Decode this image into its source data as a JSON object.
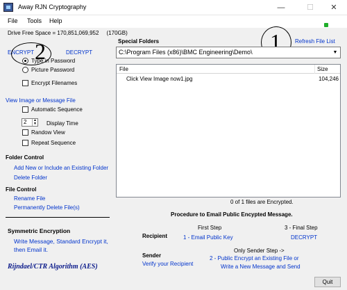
{
  "window": {
    "title": "Away RJN  Cryptography",
    "minimize": "—",
    "maximize": "☐",
    "close": "✕"
  },
  "menu": {
    "file": "File",
    "tools": "Tools",
    "help": "Help"
  },
  "drive_info": "Drive Free Space = 170,851,069,952     (170GB)",
  "mode": {
    "encrypt": "ENCRYPT",
    "decrypt": "DECRYPT"
  },
  "annotations": {
    "one": "1",
    "two": "2"
  },
  "special_folders": {
    "label": "Special Folders",
    "refresh": "Refresh File List",
    "path": "C:\\Program Files (x86)\\BMC Engineering\\Demo\\"
  },
  "options": {
    "type_in_password": "Type in Password",
    "picture_password": "Picture Password",
    "encrypt_filenames": "Encrypt Filenames"
  },
  "view": {
    "link": "View Image or Message File",
    "automatic_sequence": "Automatic Sequence",
    "display_time_value": "2",
    "display_time_label": "Display Time",
    "random_view": "Randow View",
    "repeat_sequence": "Repeat Sequence"
  },
  "folder_control": {
    "title": "Folder Control",
    "add": "Add New or Include an Existing Folder",
    "delete": "Delete Folder"
  },
  "file_control": {
    "title": "File Control",
    "rename": "Rename File",
    "delete": "Permanently Delete File(s)"
  },
  "symmetric": {
    "title": "Symmetric Encryption",
    "line1": "Write Message, Standard Encrypt it,",
    "line2": "then Email it.",
    "algorithm": "Rijndael/CTR Algorithm (AES)"
  },
  "file_list": {
    "col_file": "File",
    "col_size": "Size",
    "rows": [
      {
        "name": "Click View Image now1.jpg",
        "size": "104,246"
      }
    ]
  },
  "encrypted_status": "0 of 1 files are Encrypted.",
  "procedure": {
    "title": "Procedure to Email Public Encypted Message.",
    "first_step": "First Step",
    "final_step": "3 - Final Step",
    "recipient": "Recipient",
    "email_public_key": "1 - Email Public Key",
    "decrypt": "DECRYPT",
    "only_sender": "Only Sender Step ->",
    "sender": "Sender",
    "verify": "Verify your Recipient",
    "public_encrypt_1": "2 - Public Encrypt an Existing File or",
    "public_encrypt_2": "Write a New Message and Send"
  },
  "quit": "Quit",
  "colors": {
    "link": "#0033cc",
    "status_light": "#1fae2a",
    "background": "#f0f0f0"
  }
}
